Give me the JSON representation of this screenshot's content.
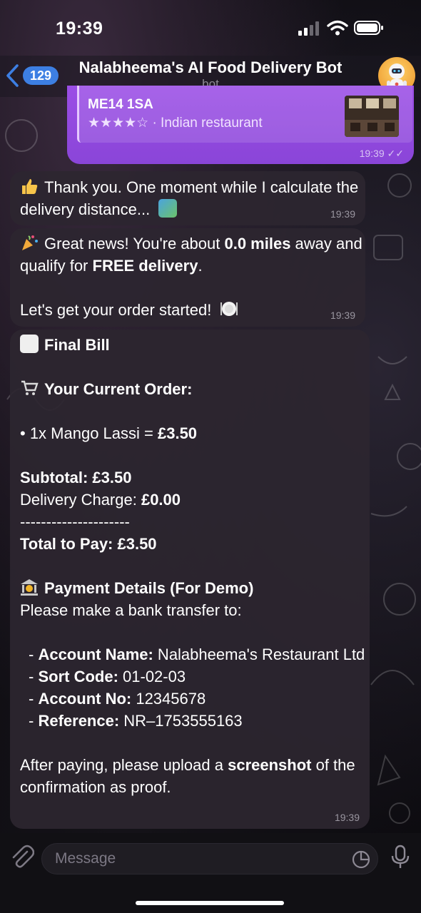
{
  "status_bar": {
    "time": "19:39"
  },
  "header": {
    "back_count": "129",
    "title": "Nalabheema's AI Food Delivery Bot",
    "subtitle": "bot"
  },
  "outgoing": {
    "address": "ME14 1SA",
    "rating_stars": "★★★★☆",
    "category": "· Indian restaurant",
    "time": "19:39"
  },
  "messages": [
    {
      "text": "Thank you. One moment while I calculate the delivery distance...",
      "time": "19:39"
    },
    {
      "line1_a": "Great news! You're about ",
      "line1_b": "0.0 miles",
      "line1_c": " away and qualify for ",
      "line1_d": "FREE delivery",
      "line1_e": ".",
      "line2": "Let's get your order started!",
      "time": "19:39"
    },
    {
      "title": "Final Bill",
      "order_heading": "Your Current Order:",
      "item_a": "• 1x Mango Lassi = ",
      "item_b": "£3.50",
      "subtotal": "Subtotal: £3.50",
      "delivery_a": "Delivery Charge: ",
      "delivery_b": "£0.00",
      "divider": "---------------------",
      "total": "Total to Pay: £3.50",
      "payment_heading": "Payment Details (For Demo)",
      "payment_intro": "Please make a bank transfer to:",
      "account_name_label": "Account Name:",
      "account_name_value": " Nalabheema's Restaurant Ltd",
      "sort_code_label": "Sort Code:",
      "sort_code_value": " 01-02-03",
      "account_no_label": "Account No:",
      "account_no_value": " 12345678",
      "reference_label": "Reference:",
      "reference_value": " NR–1753555163",
      "after_a": "After paying, please upload a ",
      "after_b": "screenshot",
      "after_c": " of the confirmation as proof.",
      "time": "19:39"
    }
  ],
  "input": {
    "placeholder": "Message"
  },
  "colors": {
    "accent": "#3d7fe3",
    "outgoing_bubble": "#9b4ee6",
    "incoming_bubble": "#2c2630"
  }
}
